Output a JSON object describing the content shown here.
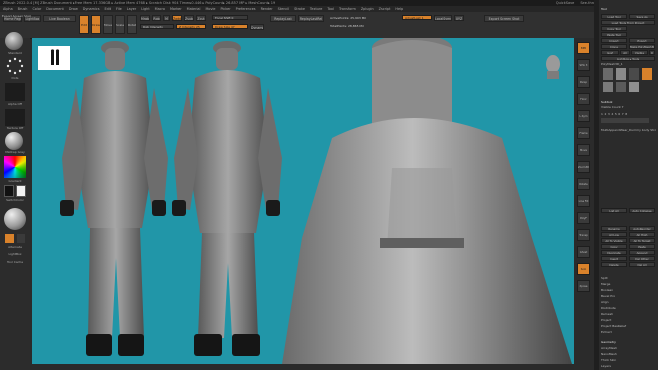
{
  "titlebar": {
    "title": "ZBrush 2022.0.4 [M]   ZBrush Document   ▸Free Mem 17.336GB ▸ Active Mem 4768 ▸ Scratch Disk 904  Timer▸0.446 ▸ PolyCount▸ 26.857 MP ▸ MeshCount▸ 19",
    "quicksave": "QuickSave",
    "see_through": "See-through 0",
    "menus": "Menus",
    "script": "DefaultZScript"
  },
  "menubar": [
    "Alpha",
    "Brush",
    "Color",
    "Document",
    "Draw",
    "Dynamics",
    "Edit",
    "File",
    "Layer",
    "Light",
    "Macro",
    "Marker",
    "Material",
    "Movie",
    "Picker",
    "Preferences",
    "Render",
    "Stencil",
    "Stroke",
    "Texture",
    "Tool",
    "Transform",
    "Zplugin",
    "Zscript",
    "Help"
  ],
  "toolbar": {
    "home_page": "Home Page",
    "lightbox": "LightBox",
    "live_boolean": "Live Boolean",
    "edit": "Edit",
    "draw": "Draw",
    "move": "Move",
    "scale": "Scale",
    "rotate": "Rotate",
    "mrgb": "Mrgb",
    "rgb": "Rgb",
    "m": "M",
    "zadd": "Zadd",
    "zsub": "Zsub",
    "zcut": "Zcut",
    "rgb_intensity": "Rgb Intensity",
    "z_intensity": "Z Intensity 25",
    "focal_shift": "Focal Shift 0",
    "draw_size": "Draw Size 47",
    "dynamic": "Dynamic",
    "replay_last": "ReplayLast",
    "replay_last_rel": "ReplayLastRel",
    "active_points": "ActivePoints: 25,993 Mil",
    "total_points": "TotalPoints: 28,865 Mil",
    "adjust_last": "AdjustLast 1",
    "export_screen": "Export Screen Shot",
    "local_sym": "LocalSymmetry",
    "sym_xyz": "XYZ"
  },
  "lefttray": {
    "header": "Export Screen Shot",
    "brush_label": "Standard",
    "stroke_label": "Dots",
    "alpha_label": "Alpha Off",
    "texture_label": "Texture Off",
    "material_label": "MatCap Gray",
    "gradient_label": "Gradient",
    "switch_label": "SwitchColor",
    "alternate_label": "Alternate",
    "lightsub_label": "LightBox",
    "bottom_label": "Tool Cache"
  },
  "righticons": [
    "BPR",
    "SPix 3",
    "Persp",
    "Floor",
    "L.Sym",
    "Frame",
    "Move",
    "Zoom3D",
    "Rotate",
    "Line Fill",
    "PolyF",
    "Transp",
    "Ghost",
    "Solo",
    "Xpose"
  ],
  "rightpanel": {
    "menu_title": "Tool",
    "load_tool": "Load Tool",
    "save_as": "Save As",
    "load_tools_from_project": "Load Tools From Project",
    "copy_tool": "Copy Tool",
    "paste_tool": "Paste Tool",
    "import": "Import",
    "export": "Export",
    "clone": "Clone",
    "make_polymesh": "Make PolyMesh3D",
    "goz": "GoZ",
    "all": "All",
    "visible": "Visible",
    "r": "R",
    "lightbox_tools": "Lightbox ▸ Tools",
    "current_tool": "PolyMesh3D_1",
    "subtool": "Subtool",
    "subtool_sub": "Visible Count 7",
    "multiappend": "MultiAppendWear_Dummy body Stroke",
    "list_all": "List All",
    "auto_collapse": "Auto Collapse",
    "rename": "Rename",
    "auto_reorder": "AutoReorder",
    "all_low": "All Low",
    "all_high": "All High",
    "all_to_visible": "All To Visible",
    "all_to_target": "All To Target",
    "copy": "Copy",
    "paste": "Paste",
    "duplicate": "Duplicate",
    "append": "Append",
    "insert": "Insert",
    "del_other": "Del Other",
    "delete": "Delete",
    "del_all": "Del All",
    "split": "Split",
    "merge": "Merge",
    "boolean": "Boolean",
    "bevel_pro": "Bevel Pro",
    "align": "Align",
    "distribute": "Distribute",
    "remesh": "Remesh",
    "project": "Project",
    "project_bas": "Project BasRelief",
    "extract": "Extract",
    "geometry": "Geometry",
    "arraymesh": "ArrayMesh",
    "nanomesh": "NanoMesh",
    "thick_skin": "Thick Skin",
    "layers": "Layers"
  },
  "colors": {
    "accent": "#d9822b",
    "viewport_bg": "#2196a8",
    "panel_bg": "#2b2b2b"
  }
}
